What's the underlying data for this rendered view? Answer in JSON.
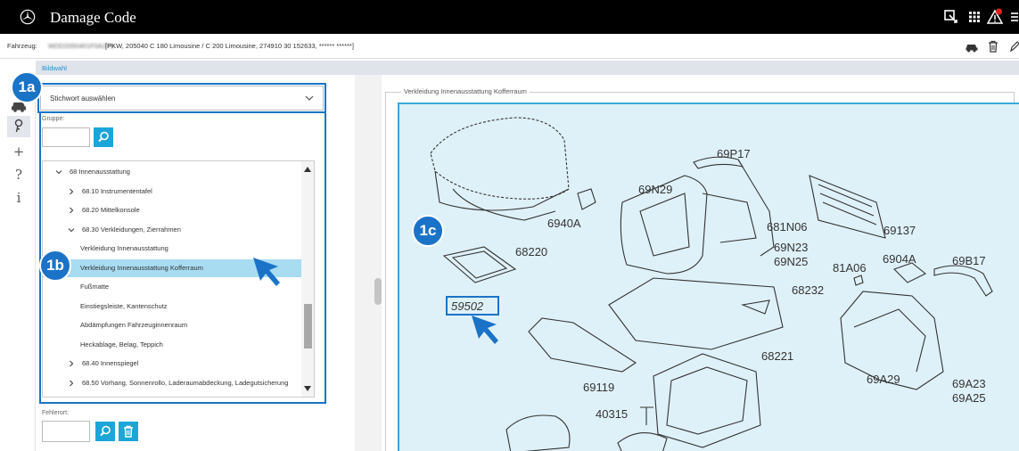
{
  "app": {
    "title": "Damage Code"
  },
  "vehicle": {
    "label": "Fahrzeug:",
    "vin_masked": "WDD2050401F0A279",
    "description": "[PKW, 205040 C 180 Limousine / C 200 Limousine, 274910 30 152633, ****** ******]"
  },
  "breadcrumb": {
    "current": "Bildwahl"
  },
  "rail": {
    "items": [
      {
        "name": "car-icon",
        "glyph": ""
      },
      {
        "name": "key-icon",
        "glyph": "🔑"
      },
      {
        "name": "plus-icon",
        "glyph": "+"
      },
      {
        "name": "help-icon",
        "glyph": "?"
      },
      {
        "name": "info-icon",
        "glyph": "i"
      }
    ]
  },
  "keyword": {
    "selected": "Stichwort auswählen"
  },
  "group": {
    "label": "Gruppe:"
  },
  "tree": {
    "items": [
      {
        "text": "68 Innenausstattung",
        "level": 0,
        "chevron": "down"
      },
      {
        "text": "68.10 Instrumententafel",
        "level": 1,
        "chevron": "right"
      },
      {
        "text": "68.20 Mittelkonsole",
        "level": 1,
        "chevron": "right"
      },
      {
        "text": "68.30 Verkleidungen, Zierrahmen",
        "level": 1,
        "chevron": "down"
      },
      {
        "text": "Verkleidung Innenausstattung",
        "level": 2,
        "chevron": ""
      },
      {
        "text": "Verkleidung Innenausstattung Kofferraum",
        "level": 2,
        "chevron": "",
        "selected": true
      },
      {
        "text": "Fußmatte",
        "level": 2,
        "chevron": ""
      },
      {
        "text": "Einstiegsleiste, Kantenschutz",
        "level": 2,
        "chevron": ""
      },
      {
        "text": "Abdämpfungen Fahrzeuginnenraum",
        "level": 2,
        "chevron": ""
      },
      {
        "text": "Heckablage, Belag, Teppich",
        "level": 2,
        "chevron": ""
      },
      {
        "text": "68.40 Innenspiegel",
        "level": 1,
        "chevron": "right"
      },
      {
        "text": "68.50 Vorhang, Sonnenrollo, Laderaumabdeckung, Ladegutsicherung",
        "level": 1,
        "chevron": "right"
      }
    ]
  },
  "fehlerort": {
    "label": "Fehlerort:"
  },
  "image_panel": {
    "legend": "Verkleidung Innenausstattung Kofferraum",
    "part_labels": [
      "69P17",
      "69N29",
      "6940A",
      "681N06",
      "69137",
      "69N23",
      "69N25",
      "68220",
      "81A06",
      "6904A",
      "69B17",
      "68232",
      "59502",
      "68221",
      "69119",
      "69A29",
      "69A23",
      "69A25",
      "40315"
    ]
  },
  "annotations": {
    "badge_1a": "1a",
    "badge_1b": "1b",
    "badge_1c": "1c"
  },
  "colors": {
    "accent": "#1b73c8",
    "button": "#1ba6d9",
    "selection": "#a8dcf1",
    "image_bg": "#dff1f8"
  }
}
